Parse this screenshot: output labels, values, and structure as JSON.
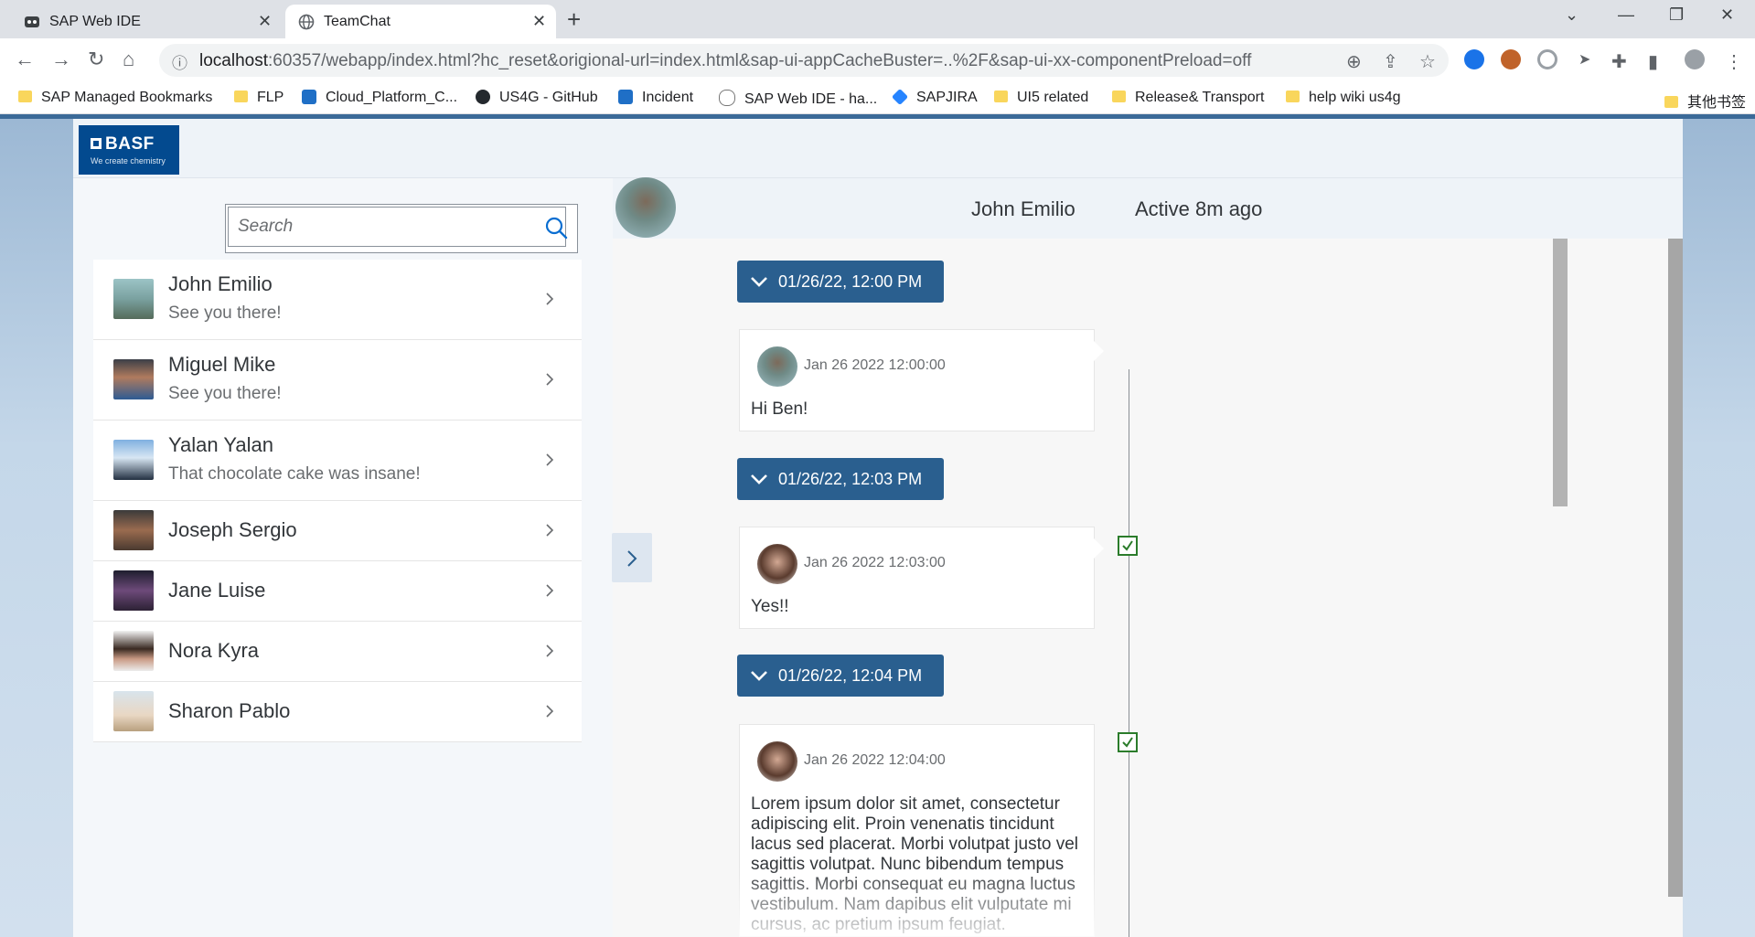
{
  "browser": {
    "tabs": [
      {
        "title": "SAP Web IDE",
        "active": false
      },
      {
        "title": "TeamChat",
        "active": true
      }
    ],
    "url_host": "localhost",
    "url_rest": ":60357/webapp/index.html?hc_reset&origional-url=index.html&sap-ui-appCacheBuster=..%2F&sap-ui-xx-componentPreload=off",
    "bookmarks": [
      {
        "label": "SAP Managed Bookmarks",
        "icon": "folder-icon"
      },
      {
        "label": "FLP",
        "icon": "folder-icon"
      },
      {
        "label": "Cloud_Platform_C...",
        "icon": "sap-icon"
      },
      {
        "label": "US4G - GitHub",
        "icon": "github-icon"
      },
      {
        "label": "Incident",
        "icon": "sap-icon"
      },
      {
        "label": "SAP Web IDE - ha...",
        "icon": "cloud-icon"
      },
      {
        "label": "SAPJIRA",
        "icon": "jira-icon"
      },
      {
        "label": "UI5 related",
        "icon": "folder-icon"
      },
      {
        "label": "Release& Transport",
        "icon": "folder-icon"
      },
      {
        "label": "help wiki us4g",
        "icon": "folder-icon"
      }
    ],
    "other_bookmarks": "其他书签"
  },
  "app": {
    "logo_main": "BASF",
    "logo_tagline": "We create chemistry",
    "search_placeholder": "Search",
    "contacts": [
      {
        "name": "John Emilio",
        "last_message": "See you there!"
      },
      {
        "name": "Miguel Mike",
        "last_message": "See you there!"
      },
      {
        "name": "Yalan Yalan",
        "last_message": "That chocolate cake was insane!"
      },
      {
        "name": "Joseph Sergio",
        "last_message": ""
      },
      {
        "name": "Jane Luise",
        "last_message": ""
      },
      {
        "name": "Nora Kyra",
        "last_message": ""
      },
      {
        "name": "Sharon Pablo",
        "last_message": ""
      }
    ],
    "chat": {
      "contact_name": "John Emilio",
      "status": "Active 8m ago",
      "messages": [
        {
          "group": "01/26/22, 12:00 PM",
          "date": "Jan 26 2022 12:00:00",
          "text": "Hi Ben!",
          "checked": false
        },
        {
          "group": "01/26/22, 12:03 PM",
          "date": "Jan 26 2022 12:03:00",
          "text": "Yes!!",
          "checked": true
        },
        {
          "group": "01/26/22, 12:04 PM",
          "date": "Jan 26 2022 12:04:00",
          "text": "Lorem ipsum dolor sit amet, consectetur adipiscing elit. Proin venenatis tincidunt lacus sed placerat. Morbi volutpat justo vel sagittis volutpat. Nunc bibendum tempus sagittis. Morbi consequat eu magna luctus vestibulum. Nam dapibus elit vulputate mi cursus, ac pretium ipsum feugiat.",
          "checked": true
        }
      ]
    }
  },
  "colors": {
    "accent": "#2a5f8f",
    "brand": "#034a8f",
    "check": "#2b7c2b"
  }
}
